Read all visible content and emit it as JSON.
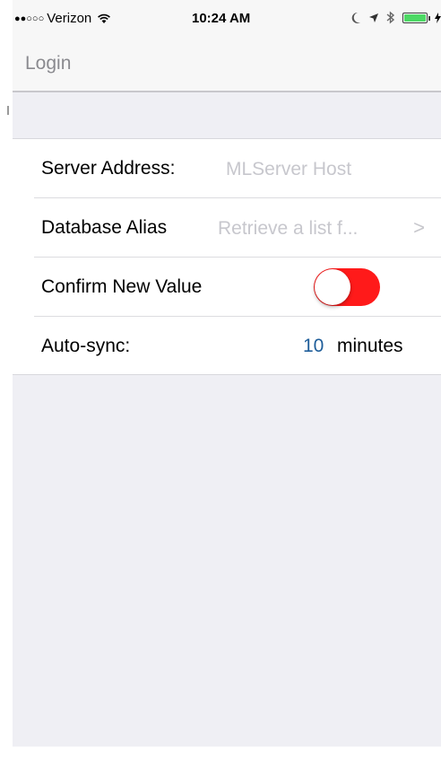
{
  "status_bar": {
    "signal": "●●○○○",
    "carrier": "Verizon",
    "time": "10:24 AM"
  },
  "nav": {
    "title": "Login"
  },
  "settings": {
    "server_address": {
      "label": "Server Address:",
      "placeholder": "MLServer Host"
    },
    "database_alias": {
      "label": "Database Alias",
      "placeholder": "Retrieve a list f...",
      "chevron": ">"
    },
    "confirm_new_value": {
      "label": "Confirm New Value",
      "on": true
    },
    "auto_sync": {
      "label": "Auto-sync:",
      "value": "10",
      "unit": "minutes"
    }
  },
  "colors": {
    "toggle_on": "#ff1a1a",
    "accent": "#1f5e9a",
    "battery": "#4cd964"
  }
}
